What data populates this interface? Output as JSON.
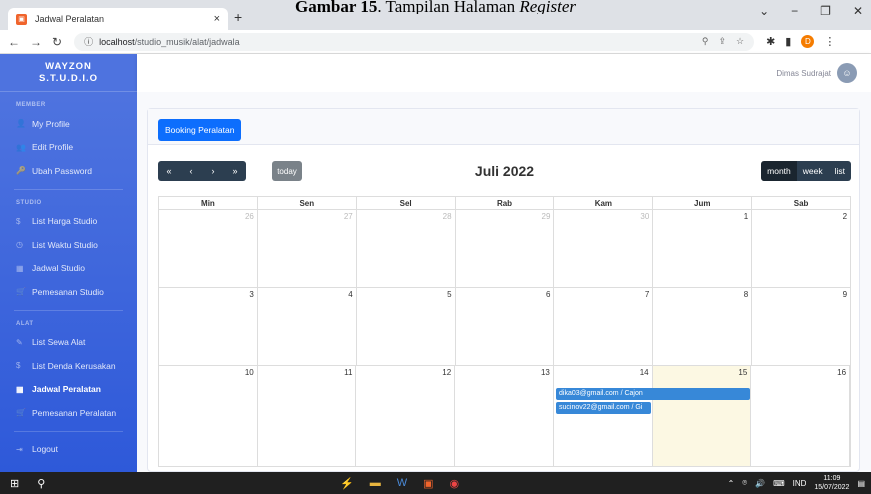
{
  "caption": {
    "prefix": "Gambar 15",
    "rest": ". Tampilan Halaman ",
    "italic": "Register"
  },
  "browser": {
    "tab_title": "Jadwal Peralatan",
    "url_host": "localhost",
    "url_path": "/studio_musik/alat/jadwala",
    "profile_initial": "D"
  },
  "brand": {
    "line1": "WAYZON",
    "line2": "S.T.U.D.I.O"
  },
  "sidebar": {
    "sections": [
      {
        "title": "MEMBER",
        "items": [
          {
            "icon": "user-icon",
            "glyph": "👤",
            "label": "My Profile"
          },
          {
            "icon": "user-edit-icon",
            "glyph": "👥",
            "label": "Edit Profile"
          },
          {
            "icon": "key-icon",
            "glyph": "🔑",
            "label": "Ubah Password"
          }
        ]
      },
      {
        "title": "STUDIO",
        "items": [
          {
            "icon": "dollar-icon",
            "glyph": "$",
            "label": "List Harga Studio"
          },
          {
            "icon": "clock-icon",
            "glyph": "◷",
            "label": "List Waktu Studio"
          },
          {
            "icon": "calendar-icon",
            "glyph": "▦",
            "label": "Jadwal Studio"
          },
          {
            "icon": "cart-icon",
            "glyph": "🛒",
            "label": "Pemesanan Studio"
          }
        ]
      },
      {
        "title": "ALAT",
        "items": [
          {
            "icon": "guitar-icon",
            "glyph": "✎",
            "label": "List Sewa Alat"
          },
          {
            "icon": "dollar-icon",
            "glyph": "$",
            "label": "List Denda Kerusakan"
          },
          {
            "icon": "calendar-icon",
            "glyph": "▦",
            "label": "Jadwal Peralatan",
            "active": true
          },
          {
            "icon": "cart-icon",
            "glyph": "🛒",
            "label": "Pemesanan Peralatan"
          }
        ]
      }
    ],
    "logout": "Logout"
  },
  "topbar": {
    "username": "Dimas Sudrajat"
  },
  "booking_button": "Booking Peralatan",
  "calendar": {
    "title": "Juli 2022",
    "today_label": "today",
    "views": [
      "month",
      "week",
      "list"
    ],
    "active_view": "month",
    "weekdays": [
      "Min",
      "Sen",
      "Sel",
      "Rab",
      "Kam",
      "Jum",
      "Sab"
    ],
    "weeks": [
      [
        {
          "d": "26",
          "o": true
        },
        {
          "d": "27",
          "o": true
        },
        {
          "d": "28",
          "o": true
        },
        {
          "d": "29",
          "o": true
        },
        {
          "d": "30",
          "o": true
        },
        {
          "d": "1"
        },
        {
          "d": "2"
        }
      ],
      [
        {
          "d": "3"
        },
        {
          "d": "4"
        },
        {
          "d": "5"
        },
        {
          "d": "6"
        },
        {
          "d": "7"
        },
        {
          "d": "8"
        },
        {
          "d": "9"
        }
      ],
      [
        {
          "d": "10"
        },
        {
          "d": "11"
        },
        {
          "d": "12"
        },
        {
          "d": "13"
        },
        {
          "d": "14"
        },
        {
          "d": "15",
          "today": true
        },
        {
          "d": "16"
        }
      ]
    ],
    "events": [
      {
        "label": "dika03@gmail.com / Cajon",
        "week": 2,
        "start": 4,
        "span": 2
      },
      {
        "label": "sucinov22@gmail.com / Gi",
        "week": 2,
        "start": 4,
        "span": 1
      }
    ]
  },
  "taskbar": {
    "lang": "IND",
    "time": "11:09",
    "date": "15/07/2022"
  }
}
